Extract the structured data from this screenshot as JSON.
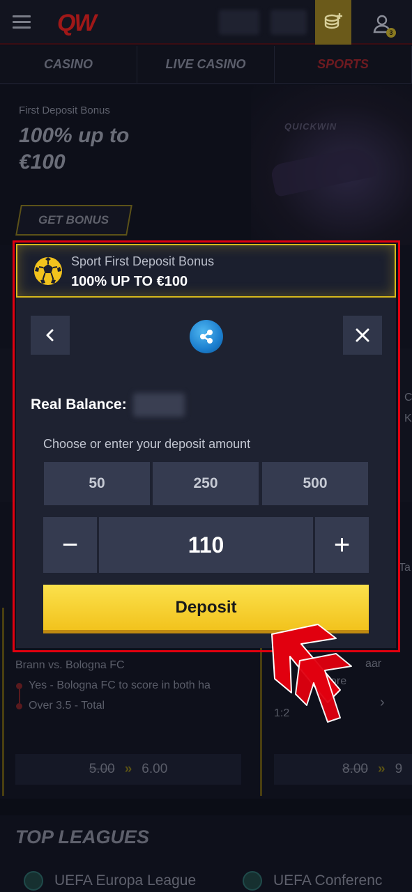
{
  "header": {
    "logo": "QW",
    "user_badge_count": "3"
  },
  "nav": {
    "tabs": [
      {
        "label": "CASINO",
        "active": false
      },
      {
        "label": "LIVE CASINO",
        "active": false
      },
      {
        "label": "SPORTS",
        "active": true
      }
    ]
  },
  "promo": {
    "label": "First Deposit Bonus",
    "title": "100% up to €100",
    "button": "GET BONUS",
    "image_text": "QUICKWIN"
  },
  "background": {
    "match_left": "Brann vs. Bologna FC",
    "bet_1": "Yes - Bologna FC to score in both ha",
    "bet_2": "Over 3.5 - Total",
    "odds_left_old": "5.00",
    "odds_left_new": "6.00",
    "match_right_1": "aar",
    "match_right_2": "ore",
    "ratio": "1:2",
    "odds_right_old": "8.00",
    "odds_right_new": "9",
    "side_text_1": "C",
    "side_text_2": "K",
    "side_text_3": "Ta",
    "top_leagues": "TOP LEAGUES",
    "league_1": "UEFA Europa League",
    "league_2": "UEFA Conferenc"
  },
  "modal": {
    "bonus_subtitle": "Sport First Deposit Bonus",
    "bonus_title": "100% UP TO €100",
    "balance_label": "Real Balance:",
    "choose_label": "Choose or enter your deposit amount",
    "amount_options": [
      "50",
      "250",
      "500"
    ],
    "amount_value": "110",
    "minus_label": "−",
    "plus_label": "+",
    "deposit_label": "Deposit"
  },
  "colors": {
    "accent_yellow": "#f2c31d",
    "highlight_red": "#e1000f",
    "modal_bg": "#1e2231",
    "ripple_blue": "#1c7fcf"
  }
}
